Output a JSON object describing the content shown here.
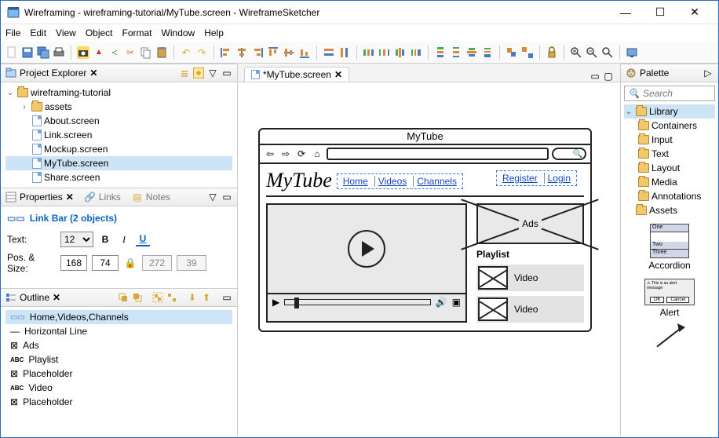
{
  "window": {
    "title": "Wireframing - wireframing-tutorial/MyTube.screen - WireframeSketcher",
    "min": "—",
    "max": "☐",
    "close": "✕"
  },
  "menu": [
    "File",
    "Edit",
    "View",
    "Object",
    "Format",
    "Window",
    "Help"
  ],
  "project_explorer": {
    "title": "Project Explorer",
    "root": "wireframing-tutorial",
    "assets": "assets",
    "files": [
      "About.screen",
      "Link.screen",
      "Mockup.screen",
      "MyTube.screen",
      "Share.screen"
    ],
    "close_x": "✕"
  },
  "properties": {
    "tab1": "Properties",
    "tab2": "Links",
    "tab3": "Notes",
    "heading": "Link Bar (2 objects)",
    "text_label": "Text:",
    "pos_label": "Pos. & Size:",
    "font_size": "12",
    "pos_x": "168",
    "pos_y": "74",
    "w": "272",
    "h": "39",
    "bold": "B",
    "italic": "I",
    "underline": "U"
  },
  "outline": {
    "title": "Outline",
    "items": [
      "Home,Videos,Channels",
      "Horizontal Line",
      "Ads",
      "Playlist",
      "Placeholder",
      "Video",
      "Placeholder"
    ]
  },
  "editor": {
    "tab": "*MyTube.screen",
    "browser_title": "MyTube",
    "logo": "MyTube",
    "nav_links": [
      "Home",
      "Videos",
      "Channels"
    ],
    "auth_links": [
      "Register",
      "Login"
    ],
    "ads": "Ads",
    "playlist": "Playlist",
    "video_item": "Video"
  },
  "palette": {
    "title": "Palette",
    "search": "Search",
    "library": "Library",
    "cats": [
      "Containers",
      "Input",
      "Text",
      "Layout",
      "Media",
      "Annotations"
    ],
    "assets": "Assets",
    "w_accordion": "Accordion",
    "w_alert": "Alert",
    "acc_rows": [
      "One",
      "",
      "Two",
      "Three"
    ],
    "alert_msg": "⚠ This is an alert message",
    "alert_ok": "OK",
    "alert_cancel": "Cancel"
  }
}
